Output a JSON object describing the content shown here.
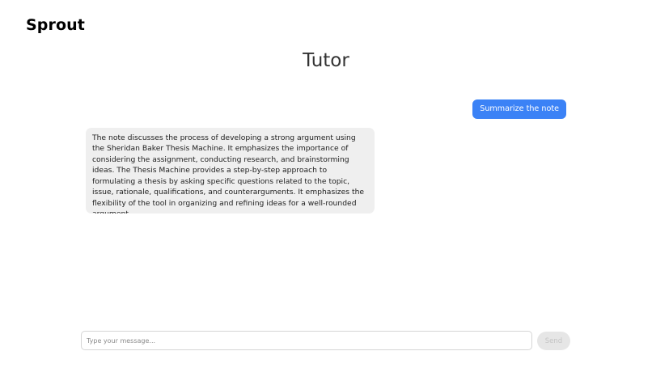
{
  "header": {
    "brand": "Sprout"
  },
  "main": {
    "title": "Tutor",
    "messages": [
      {
        "role": "user",
        "text": "Summarize the note"
      },
      {
        "role": "assistant",
        "text": "The note discusses the process of developing a strong argument using the Sheridan Baker Thesis Machine. It emphasizes the importance of considering the assignment, conducting research, and brainstorming ideas. The Thesis Machine provides a step-by-step approach to formulating a thesis by asking specific questions related to the topic, issue, rationale, qualifications, and counterarguments. It emphasizes the flexibility of the tool in organizing and refining ideas for a well-rounded argument."
      }
    ]
  },
  "composer": {
    "placeholder": "Type your message...",
    "value": "",
    "send_label": "Send",
    "send_enabled": false
  },
  "colors": {
    "accent": "#3b82f6",
    "assistant_bubble": "#efefef",
    "send_disabled_bg": "#e6e6e6",
    "send_disabled_text": "#c4c4c4"
  }
}
